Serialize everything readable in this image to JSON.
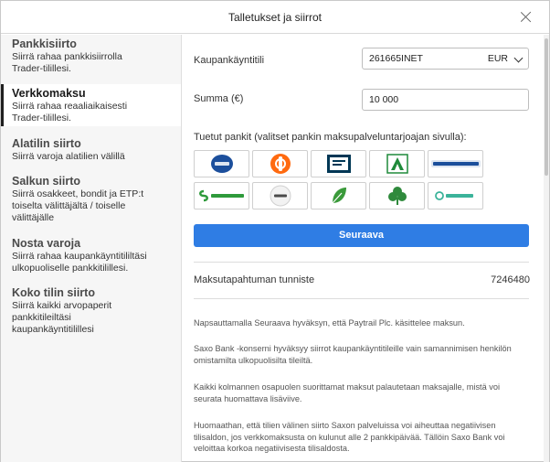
{
  "dialog": {
    "title": "Talletukset ja siirrot",
    "close_icon": "close-icon"
  },
  "sidebar": {
    "items": [
      {
        "title": "Pankkisiirto",
        "desc": "Siirrä rahaa pankkisiirrolla Trader-tilillesi.",
        "active": false
      },
      {
        "title": "Verkkomaksu",
        "desc": "Siirrä rahaa reaaliaikaisesti Trader-tilillesi.",
        "active": true
      },
      {
        "title": "Alatilin siirto",
        "desc": "Siirrä varoja alatilien välillä",
        "active": false
      },
      {
        "title": "Salkun siirto",
        "desc": "Siirrä osakkeet, bondit ja ETP:t toiselta välittäjältä / toiselle välittäjälle",
        "active": false
      },
      {
        "title": "Nosta varoja",
        "desc": "Siirrä rahaa kaupankäyntitililtäsi ulkopuoliselle pankkitilillesi.",
        "active": false
      },
      {
        "title": "Koko tilin siirto",
        "desc": "Siirrä kaikki arvopaperit pankkitileiltäsi kaupankäyntitilillesi",
        "active": false
      }
    ]
  },
  "form": {
    "account_label": "Kaupankäyntitili",
    "account_value": "261665INET",
    "account_currency": "EUR",
    "amount_label": "Summa (€)",
    "amount_value": "10 000",
    "banks_label": "Tuetut pankit (valitset pankin maksupalveluntarjoajan sivulla):",
    "banks": [
      {
        "name": "Nordea",
        "icon": "nordea-logo-icon",
        "color": "#1c4f9c"
      },
      {
        "name": "OP",
        "icon": "op-logo-icon",
        "color": "#ff6a10"
      },
      {
        "name": "Bank",
        "icon": "danske-bank-logo-icon",
        "color": "#003755"
      },
      {
        "name": "Ålandsbanken",
        "icon": "alandsbanken-logo-icon",
        "color": "#1f8a3a"
      },
      {
        "name": "Handelsbanken",
        "icon": "handelsbanken-logo-icon",
        "color": "#1b4f9b"
      },
      {
        "name": "S-Pankki",
        "icon": "s-pankki-logo-icon",
        "color": "#2e9a3b"
      },
      {
        "name": "Aktia",
        "icon": "aktia-logo-icon",
        "color": "#5a5a5a"
      },
      {
        "name": "Säästöpankki",
        "icon": "saastopankki-logo-icon",
        "color": "#3a9a3a"
      },
      {
        "name": "POP Pankki",
        "icon": "pop-pankki-logo-icon",
        "color": "#2f8a3c"
      },
      {
        "name": "omaSp",
        "icon": "omasp-logo-icon",
        "color": "#3bb39a"
      }
    ],
    "next_button": "Seuraava",
    "reference_label": "Maksutapahtuman tunniste",
    "reference_value": "7246480"
  },
  "notes": [
    "Napsauttamalla Seuraava hyväksyn, että Paytrail Plc. käsittelee maksun.",
    "Saxo Bank -konserni hyväksyy siirrot kaupankäyntitileille vain samannimisen henkilön omistamilta ulkopuolisilta tileiltä.",
    "Kaikki kolmannen osapuolen suorittamat maksut palautetaan maksajalle, mistä voi seurata huomattava lisäviive.",
    "Huomaathan, että tilien välinen siirto Saxon palveluissa voi aiheuttaa negatiivisen tilisaldon, jos verkkomaksusta on kulunut alle 2 pankkipäivää. Tällöin Saxo Bank voi veloittaa korkoa negatiivisesta tilisaldosta."
  ]
}
